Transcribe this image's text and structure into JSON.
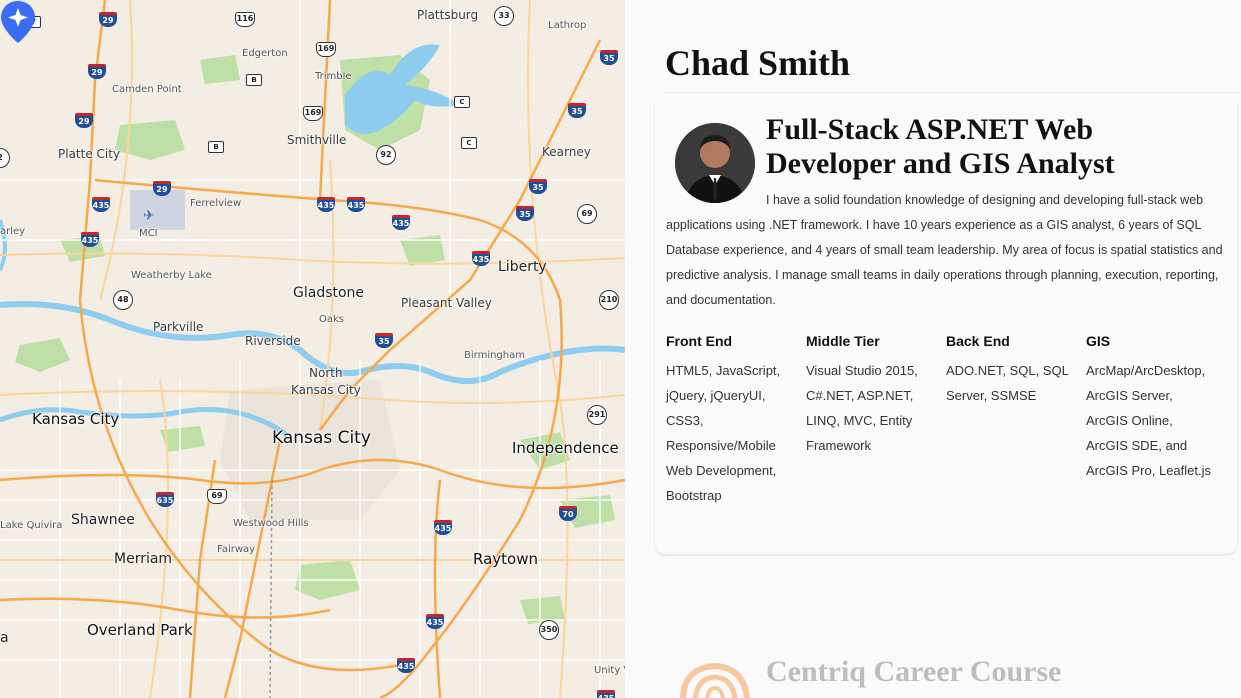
{
  "map": {
    "places": [
      {
        "name": "Plattsburg",
        "size": "sm"
      },
      {
        "name": "Lathrop",
        "size": "xs"
      },
      {
        "name": "Edgerton",
        "size": "xs"
      },
      {
        "name": "Trimble",
        "size": "xs"
      },
      {
        "name": "Camden Point",
        "size": "xs"
      },
      {
        "name": "Smithville",
        "size": "sm"
      },
      {
        "name": "Platte City",
        "size": "sm"
      },
      {
        "name": "Kearney",
        "size": "sm"
      },
      {
        "name": "Ferrelview",
        "size": "xs"
      },
      {
        "name": "MCI",
        "size": "xs"
      },
      {
        "name": "Weatherby Lake",
        "size": "xs"
      },
      {
        "name": "Liberty",
        "size": "md"
      },
      {
        "name": "Gladstone",
        "size": "md"
      },
      {
        "name": "Pleasant Valley",
        "size": "sm"
      },
      {
        "name": "Oaks",
        "size": "xs"
      },
      {
        "name": "Parkville",
        "size": "sm"
      },
      {
        "name": "Riverside",
        "size": "sm"
      },
      {
        "name": "Birmingham",
        "size": "xs"
      },
      {
        "name": "North",
        "size": "sm"
      },
      {
        "name": "Kansas City",
        "size": "sm"
      },
      {
        "name": "Kansas City",
        "size": "lg"
      },
      {
        "name": "Kansas City",
        "size": "xl"
      },
      {
        "name": "Independence",
        "size": "lg"
      },
      {
        "name": "Shawnee",
        "size": "md"
      },
      {
        "name": "Westwood Hills",
        "size": "xs"
      },
      {
        "name": "Lake Quivira",
        "size": "xs"
      },
      {
        "name": "Fairway",
        "size": "xs"
      },
      {
        "name": "Merriam",
        "size": "md"
      },
      {
        "name": "Raytown",
        "size": "lg"
      },
      {
        "name": "Overland Park",
        "size": "lg"
      },
      {
        "name": "Unity V",
        "size": "xs"
      },
      {
        "name": "arley",
        "size": "xs"
      },
      {
        "name": "a",
        "size": "md"
      }
    ],
    "shields": [
      "V",
      "29",
      "116",
      "33",
      "169",
      "35",
      "29",
      "B",
      "169",
      "C",
      "29",
      "35",
      "B",
      "C",
      "92",
      "29",
      "435",
      "435",
      "435",
      "35",
      "69",
      "435",
      "435",
      "35",
      "435",
      "48",
      "210",
      "35",
      "291",
      "635",
      "69",
      "70",
      "435",
      "350",
      "435",
      "435",
      "435",
      "2"
    ]
  },
  "profile": {
    "name": "Chad Smith",
    "headline": "Full-Stack ASP.NET Web Developer and GIS Analyst",
    "bio": "I have a solid foundation knowledge of designing and developing full-stack web applications using .NET framework. I have 10 years experience as a GIS analyst, 6 years of SQL Database experience, and 4 years of small team leadership. My area of focus is spatial statistics and predictive analysis. I manage small teams in daily operations through planning, execution, reporting, and documentation.",
    "skills": [
      {
        "heading": "Front End",
        "text": "HTML5, JavaScript, jQuery, jQueryUI, CSS3, Responsive/Mobile Web Development, Bootstrap"
      },
      {
        "heading": "Middle Tier",
        "text": "Visual Studio 2015, C#.NET, ASP.NET, LINQ, MVC, Entity Framework"
      },
      {
        "heading": "Back End",
        "text": "ADO.NET, SQL, SQL Server, SSMSE"
      },
      {
        "heading": "GIS",
        "text": "ArcMap/ArcDesktop, ArcGIS Server, ArcGIS Online, ArcGIS SDE, and ArcGIS Pro, Leaflet.js"
      }
    ]
  },
  "next_section": {
    "title": "Centriq Career Course"
  },
  "colors": {
    "map_land": "#f3ede4",
    "map_water": "#8ecdf0",
    "map_park": "#b9dea0",
    "map_highway": "#f6a84c",
    "pin": "#3a6cf4",
    "panel_bg": "#fafafa"
  }
}
